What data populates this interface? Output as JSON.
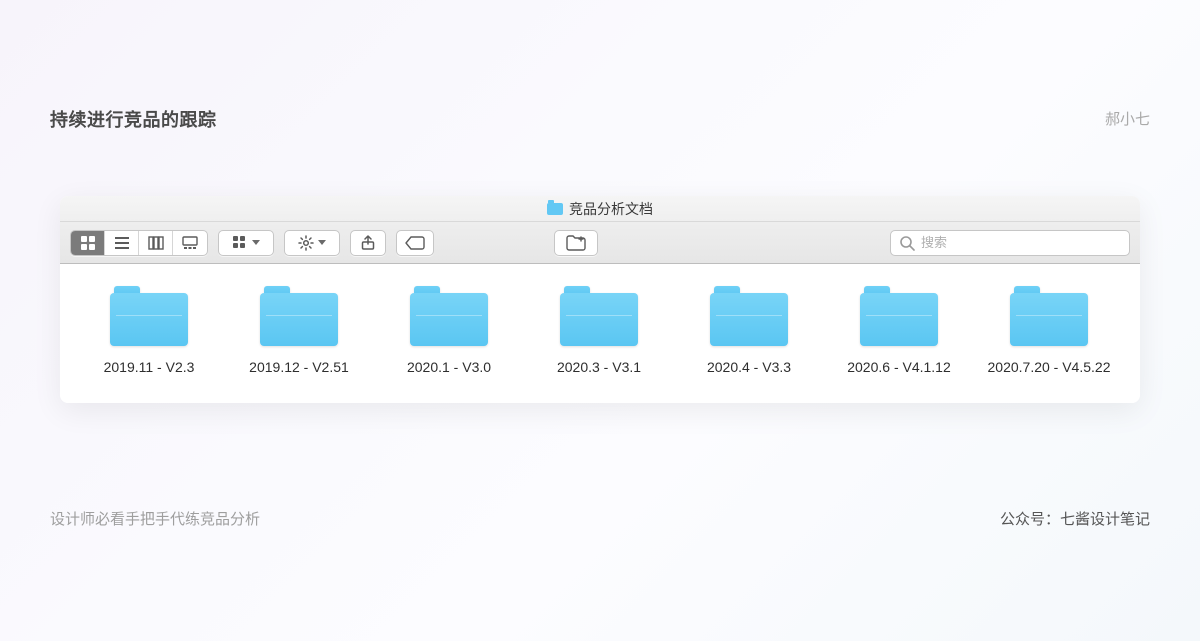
{
  "page": {
    "title": "持续进行竞品的跟踪",
    "author": "郝小七",
    "footer_left": "设计师必看手把手代练竞品分析",
    "footer_right": "公众号：七酱设计笔记"
  },
  "finder": {
    "window_title": "竞品分析文档",
    "search_placeholder": "搜索",
    "folders": [
      {
        "label": "2019.11 - V2.3"
      },
      {
        "label": "2019.12 - V2.51"
      },
      {
        "label": "2020.1 - V3.0"
      },
      {
        "label": "2020.3 - V3.1"
      },
      {
        "label": "2020.4 - V3.3"
      },
      {
        "label": "2020.6 - V4.1.12"
      },
      {
        "label": "2020.7.20 - V4.5.22"
      }
    ]
  }
}
